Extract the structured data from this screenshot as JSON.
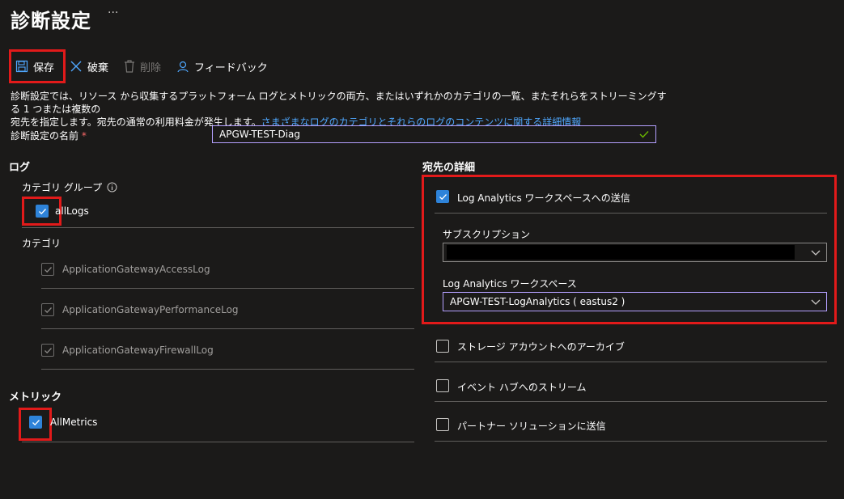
{
  "page": {
    "title": "診断設定",
    "more": "···"
  },
  "toolbar": {
    "save": "保存",
    "discard": "破棄",
    "delete": "削除",
    "feedback": "フィードバック"
  },
  "description": {
    "line1": "診断設定では、リソース から収集するプラットフォーム ログとメトリックの両方、またはいずれかのカテゴリの一覧、またそれらをストリーミングする 1 つまたは複数の",
    "line2": "宛先を指定します。宛先の通常の利用料金が発生します。",
    "link": "さまざまなログのカテゴリとそれらのログのコンテンツに関する詳細情報"
  },
  "name_field": {
    "label": "診断設定の名前",
    "required": "*",
    "value": "APGW-TEST-Diag"
  },
  "logs": {
    "heading": "ログ",
    "category_group_label": "カテゴリ グループ",
    "all_logs": "allLogs",
    "category_label": "カテゴリ",
    "categories": [
      "ApplicationGatewayAccessLog",
      "ApplicationGatewayPerformanceLog",
      "ApplicationGatewayFirewallLog"
    ]
  },
  "metrics": {
    "heading": "メトリック",
    "all_metrics": "AllMetrics"
  },
  "destination": {
    "heading": "宛先の詳細",
    "log_analytics": {
      "label": "Log Analytics ワークスペースへの送信",
      "subscription_label": "サブスクリプション",
      "workspace_label": "Log Analytics ワークスペース",
      "workspace_value": "APGW-TEST-LogAnalytics ( eastus2 )"
    },
    "storage": "ストレージ アカウントへのアーカイブ",
    "event_hub": "イベント ハブへのストリーム",
    "partner": "パートナー ソリューションに送信"
  },
  "colors": {
    "accent": "#2e83d9",
    "highlight": "#e21a1a",
    "link": "#4fa8ff",
    "input_border": "#b4a0ff"
  }
}
